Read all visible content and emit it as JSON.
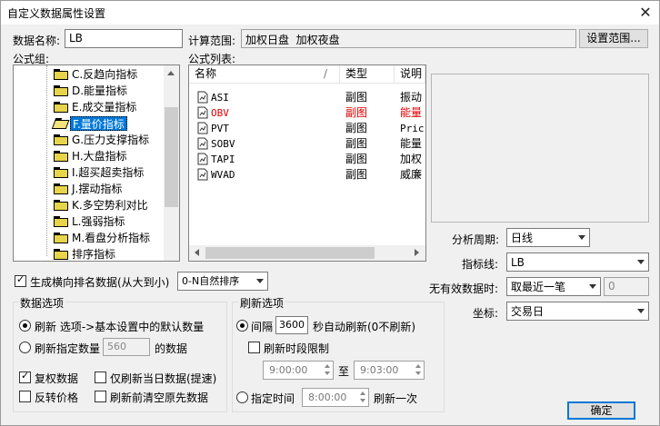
{
  "window": {
    "title": "自定义数据属性设置",
    "close_glyph": "✕"
  },
  "data_name": {
    "label": "数据名称:",
    "value": "LB"
  },
  "calc_range": {
    "label": "计算范围:",
    "value": "加权日盘  加权夜盘",
    "button": "设置范围..."
  },
  "formula_group": {
    "label": "公式组:",
    "items": [
      {
        "text": "C.反趋向指标",
        "selected": false
      },
      {
        "text": "D.能量指标",
        "selected": false
      },
      {
        "text": "E.成交量指标",
        "selected": false
      },
      {
        "text": "F.量价指标",
        "selected": true
      },
      {
        "text": "G.压力支撑指标",
        "selected": false
      },
      {
        "text": "H.大盘指标",
        "selected": false
      },
      {
        "text": "I.超买超卖指标",
        "selected": false
      },
      {
        "text": "J.摆动指标",
        "selected": false
      },
      {
        "text": "K.多空势利对比",
        "selected": false
      },
      {
        "text": "L.强弱指标",
        "selected": false
      },
      {
        "text": "M.看盘分析指标",
        "selected": false
      },
      {
        "text": "排序指标",
        "selected": false
      }
    ]
  },
  "formula_list": {
    "label": "公式列表:",
    "columns": [
      "名称",
      "类型",
      "说明"
    ],
    "sort_glyph": "/",
    "rows": [
      {
        "name": "ASI",
        "type": "副图",
        "desc": "振动",
        "highlight": false
      },
      {
        "name": "OBV",
        "type": "副图",
        "desc": "能量",
        "highlight": true
      },
      {
        "name": "PVT",
        "type": "副图",
        "desc": "Pric",
        "highlight": false
      },
      {
        "name": "SOBV",
        "type": "副图",
        "desc": "能量",
        "highlight": false
      },
      {
        "name": "TAPI",
        "type": "副图",
        "desc": "加权",
        "highlight": false
      },
      {
        "name": "WVAD",
        "type": "副图",
        "desc": "威廉",
        "highlight": false
      }
    ]
  },
  "right_panel": {
    "period": {
      "label": "分析周期:",
      "value": "日线"
    },
    "indicator_line": {
      "label": "指标线:",
      "value": "LB"
    },
    "no_data": {
      "label": "无有效数据时:",
      "value": "取最近一笔",
      "number": "0"
    },
    "axis": {
      "label": "坐标:",
      "value": "交易日"
    }
  },
  "rank": {
    "label": "生成横向排名数据(从大到小)",
    "checked": true,
    "sort_value": "0-N自然排序"
  },
  "data_options": {
    "title": "数据选项",
    "refresh_default": "刷新 选项->基本设置中的默认数量",
    "refresh_count_label": "刷新指定数量",
    "refresh_count_value": "560",
    "refresh_count_suffix": "的数据",
    "reinstate": "复权数据",
    "today_only": "仅刷新当日数据(提速)",
    "reverse_price": "反转价格",
    "clear_before": "刷新前清空原先数据"
  },
  "refresh_options": {
    "title": "刷新选项",
    "interval_label": "间隔",
    "interval_value": "3600",
    "interval_suffix": "秒自动刷新(0不刷新)",
    "time_limit": "刷新时段限制",
    "from_time": "9:00:00",
    "to_label": "至",
    "to_time": "9:03:00",
    "fixed_time_label": "指定时间",
    "fixed_time": "8:00:00",
    "fixed_time_suffix": "刷新一次"
  },
  "ok_button": "确定"
}
